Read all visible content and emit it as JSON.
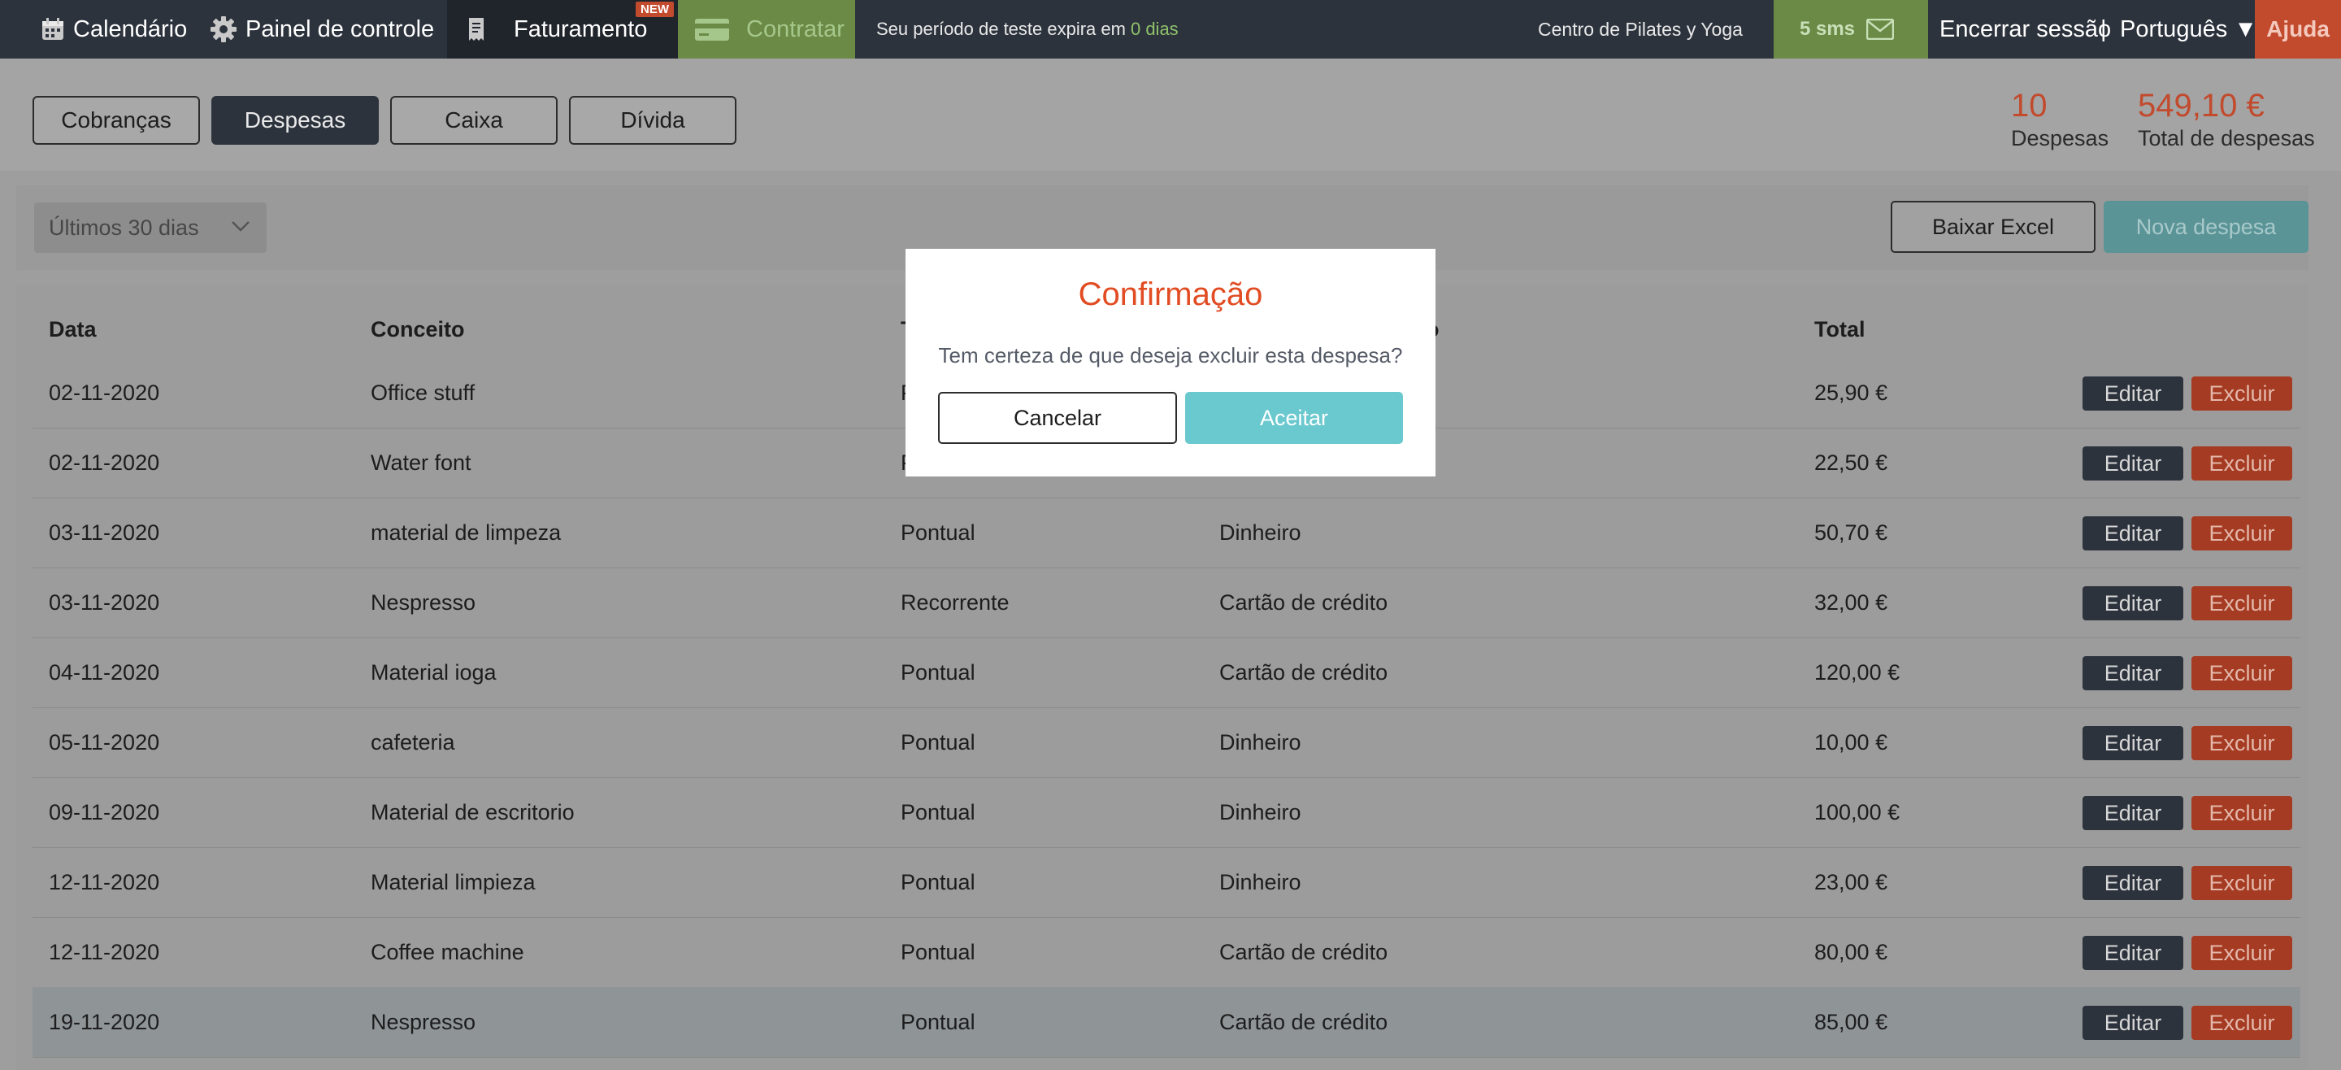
{
  "topbar": {
    "calendar_label": "Calendário",
    "panel_label": "Painel de controle",
    "billing_label": "Faturamento",
    "new_badge": "NEW",
    "hire_label": "Contratar",
    "trial_text": "Seu período de teste expira em",
    "trial_days": "0 dias",
    "center_name": "Centro de Pilates y Yoga",
    "sms_label": "5 sms",
    "logout_label": "Encerrar sessão",
    "separator": "|",
    "language_label": "Português ▼",
    "help_label": "Ajuda"
  },
  "tabs": [
    {
      "label": "Cobranças",
      "active": false
    },
    {
      "label": "Despesas",
      "active": true
    },
    {
      "label": "Caixa",
      "active": false
    },
    {
      "label": "Dívida",
      "active": false
    }
  ],
  "stats": {
    "count_value": "10",
    "count_label": "Despesas",
    "total_value": "549,10 €",
    "total_label": "Total de despesas"
  },
  "filters": {
    "period_selected": "Últimos 30 dias",
    "excel_button": "Baixar Excel",
    "new_button": "Nova despesa"
  },
  "table": {
    "headers": [
      "Data",
      "Conceito",
      "T",
      "o",
      "Total"
    ],
    "edit_label": "Editar",
    "delete_label": "Excluir",
    "rows": [
      {
        "date": "02-11-2020",
        "concept": "Office stuff",
        "type": "P",
        "payment": "",
        "total": "25,90 €"
      },
      {
        "date": "02-11-2020",
        "concept": "Water font",
        "type": "P",
        "payment": "",
        "total": "22,50 €"
      },
      {
        "date": "03-11-2020",
        "concept": "material de limpeza",
        "type": "Pontual",
        "payment": "Dinheiro",
        "total": "50,70 €"
      },
      {
        "date": "03-11-2020",
        "concept": "Nespresso",
        "type": "Recorrente",
        "payment": "Cartão de crédito",
        "total": "32,00 €"
      },
      {
        "date": "04-11-2020",
        "concept": "Material ioga",
        "type": "Pontual",
        "payment": "Cartão de crédito",
        "total": "120,00 €"
      },
      {
        "date": "05-11-2020",
        "concept": "cafeteria",
        "type": "Pontual",
        "payment": "Dinheiro",
        "total": "10,00 €"
      },
      {
        "date": "09-11-2020",
        "concept": "Material de escritorio",
        "type": "Pontual",
        "payment": "Dinheiro",
        "total": "100,00 €"
      },
      {
        "date": "12-11-2020",
        "concept": "Material limpieza",
        "type": "Pontual",
        "payment": "Dinheiro",
        "total": "23,00 €"
      },
      {
        "date": "12-11-2020",
        "concept": "Coffee machine",
        "type": "Pontual",
        "payment": "Cartão de crédito",
        "total": "80,00 €"
      },
      {
        "date": "19-11-2020",
        "concept": "Nespresso",
        "type": "Pontual",
        "payment": "Cartão de crédito",
        "total": "85,00 €"
      }
    ]
  },
  "modal": {
    "title": "Confirmação",
    "message": "Tem certeza de que deseja excluir esta despesa?",
    "cancel_label": "Cancelar",
    "accept_label": "Aceitar"
  },
  "colors": {
    "topbar": "#2d333d",
    "accent_red": "#e14c23",
    "accept_teal": "#6ac8cf",
    "trial_green": "#8fc26a"
  }
}
